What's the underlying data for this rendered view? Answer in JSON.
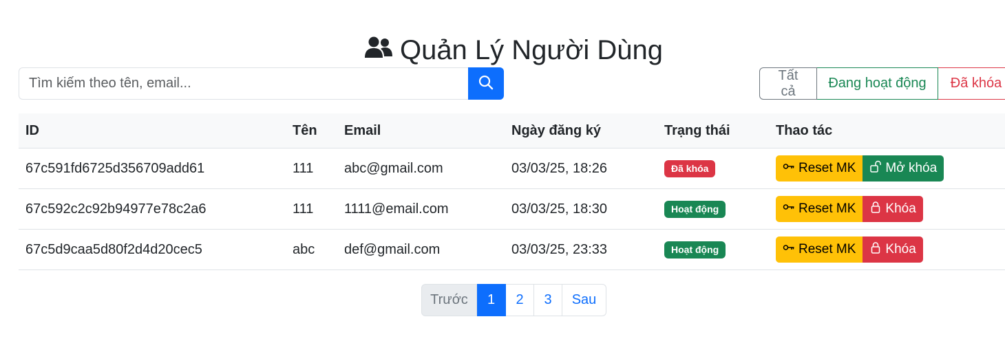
{
  "header": {
    "title": "Quản Lý Người Dùng",
    "icon": "users-icon"
  },
  "search": {
    "placeholder": "Tìm kiếm theo tên, email...",
    "value": ""
  },
  "filters": {
    "all": "Tất cả",
    "active": "Đang hoạt động",
    "locked": "Đã khóa"
  },
  "table": {
    "columns": [
      "ID",
      "Tên",
      "Email",
      "Ngày đăng ký",
      "Trạng thái",
      "Thao tác"
    ],
    "rows": [
      {
        "id": "67c591fd6725d356709add61",
        "name": "111",
        "email": "abc@gmail.com",
        "date": "03/03/25, 18:26",
        "status": "Đã khóa",
        "reset": "Reset MK",
        "toggle": "Mở khóa"
      },
      {
        "id": "67c592c2c92b94977e78c2a6",
        "name": "111",
        "email": "1111@email.com",
        "date": "03/03/25, 18:30",
        "status": "Hoạt động",
        "reset": "Reset MK",
        "toggle": "Khóa"
      },
      {
        "id": "67c5d9caa5d80f2d4d20cec5",
        "name": "abc",
        "email": "def@gmail.com",
        "date": "03/03/25, 23:33",
        "status": "Hoạt động",
        "reset": "Reset MK",
        "toggle": "Khóa"
      }
    ]
  },
  "pagination": {
    "prev": "Trước",
    "pages": [
      "1",
      "2",
      "3"
    ],
    "next": "Sau",
    "current": "1"
  },
  "colors": {
    "primary": "#0d6efd",
    "success": "#198754",
    "danger": "#dc3545",
    "warning": "#ffc107",
    "secondary": "#6c757d"
  }
}
